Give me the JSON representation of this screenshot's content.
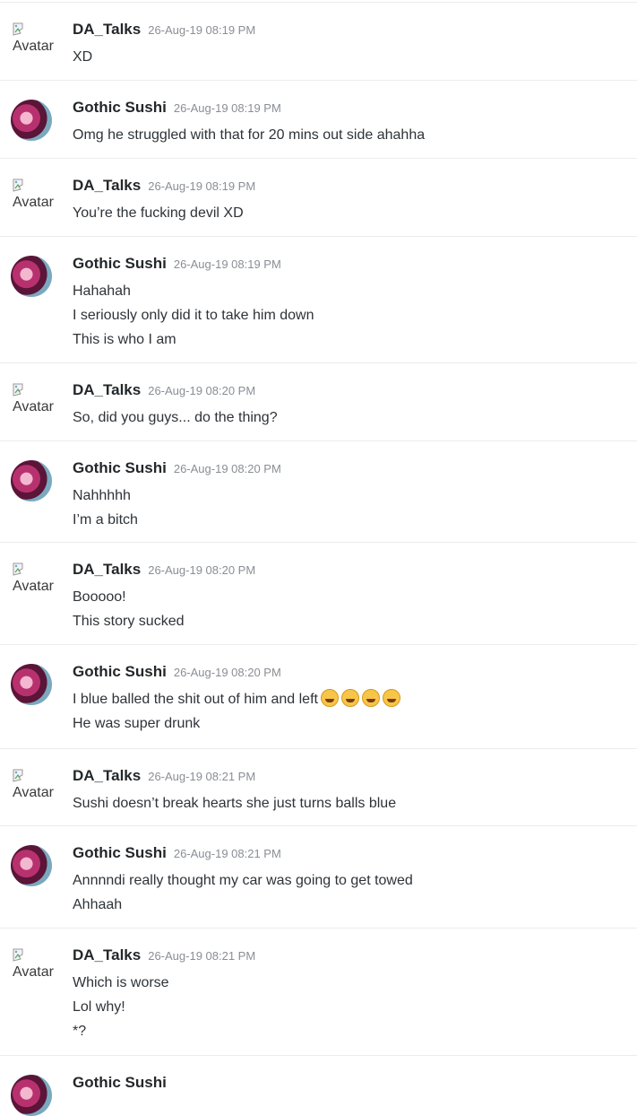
{
  "broken_avatar_alt": "Avatar",
  "emoji_name": "rolling-on-floor-laughing",
  "messages": [
    {
      "author": "DA_Talks",
      "time": "26-Aug-19 08:19 PM",
      "avatar": "broken",
      "lines": [
        "XD"
      ]
    },
    {
      "author": "Gothic Sushi",
      "time": "26-Aug-19 08:19 PM",
      "avatar": "image",
      "lines": [
        "Omg he struggled with that for 20 mins out side ahahha"
      ]
    },
    {
      "author": "DA_Talks",
      "time": "26-Aug-19 08:19 PM",
      "avatar": "broken",
      "lines": [
        "You’re the fucking devil XD"
      ]
    },
    {
      "author": "Gothic Sushi",
      "time": "26-Aug-19 08:19 PM",
      "avatar": "image",
      "lines": [
        "Hahahah",
        "I seriously only did it to take him down",
        "This is who I am"
      ]
    },
    {
      "author": "DA_Talks",
      "time": "26-Aug-19 08:20 PM",
      "avatar": "broken",
      "lines": [
        "So, did you guys... do the thing?"
      ]
    },
    {
      "author": "Gothic Sushi",
      "time": "26-Aug-19 08:20 PM",
      "avatar": "image",
      "lines": [
        "Nahhhhh",
        "I’m a bitch"
      ]
    },
    {
      "author": "DA_Talks",
      "time": "26-Aug-19 08:20 PM",
      "avatar": "broken",
      "lines": [
        "Booooo!",
        "This story sucked"
      ]
    },
    {
      "author": "Gothic Sushi",
      "time": "26-Aug-19 08:20 PM",
      "avatar": "image",
      "lines": [
        "I blue balled the shit out of him and left",
        "He was super drunk"
      ],
      "emoji_after_line": 0,
      "emoji_count": 4
    },
    {
      "author": "DA_Talks",
      "time": "26-Aug-19 08:21 PM",
      "avatar": "broken",
      "lines": [
        "Sushi doesn’t break hearts she just turns balls blue"
      ]
    },
    {
      "author": "Gothic Sushi",
      "time": "26-Aug-19 08:21 PM",
      "avatar": "image",
      "lines": [
        "Annnndi really thought my car was going to get towed",
        "Ahhaah"
      ]
    },
    {
      "author": "DA_Talks",
      "time": "26-Aug-19 08:21 PM",
      "avatar": "broken",
      "lines": [
        "Which is worse",
        "Lol why!",
        "*?"
      ]
    },
    {
      "author": "Gothic Sushi",
      "time": "",
      "avatar": "image",
      "lines": []
    }
  ]
}
